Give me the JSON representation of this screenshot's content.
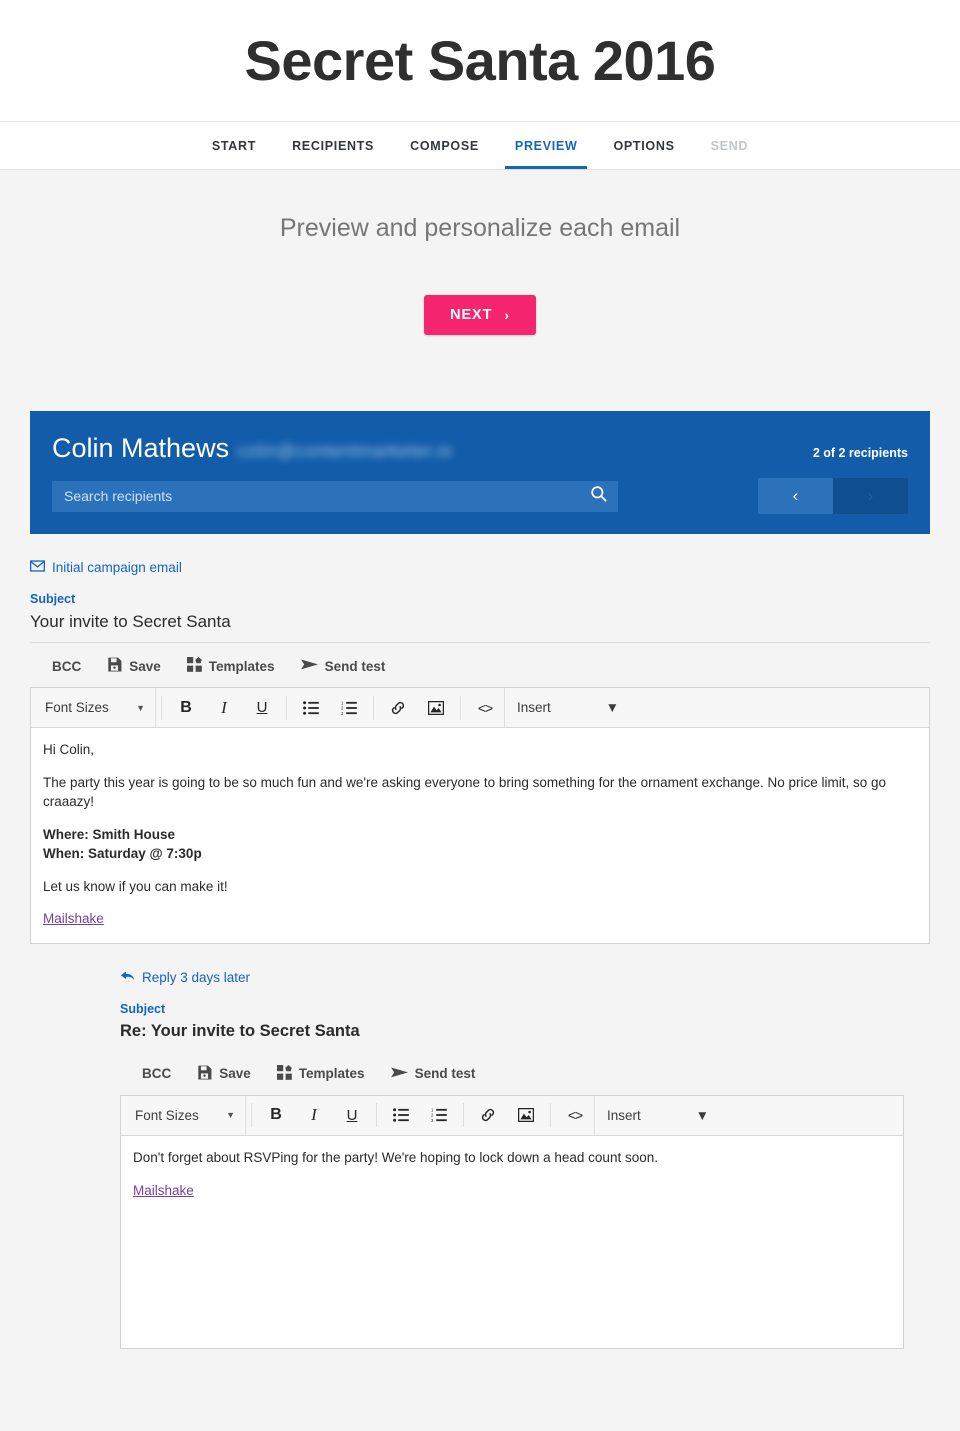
{
  "app": {
    "title": "Secret Santa 2016"
  },
  "nav": {
    "items": [
      {
        "label": "START",
        "state": "normal"
      },
      {
        "label": "RECIPIENTS",
        "state": "normal"
      },
      {
        "label": "COMPOSE",
        "state": "normal"
      },
      {
        "label": "PREVIEW",
        "state": "active"
      },
      {
        "label": "OPTIONS",
        "state": "normal"
      },
      {
        "label": "SEND",
        "state": "disabled"
      }
    ]
  },
  "subhead": {
    "title": "Preview and personalize each email",
    "next_label": "NEXT",
    "next_chevron": "›"
  },
  "recipient": {
    "name": "Colin Mathews",
    "email": "colin@contentmarketer.io",
    "count": "2 of 2 recipients",
    "search_placeholder": "Search recipients",
    "prev_glyph": "‹",
    "next_glyph": "›"
  },
  "emails": [
    {
      "tag": "Initial campaign email",
      "tag_icon": "envelope-icon",
      "subject_label": "Subject",
      "subject": "Your invite to Secret Santa",
      "actions": [
        {
          "label": "BCC",
          "icon": "none"
        },
        {
          "label": "Save",
          "icon": "floppy-disk-icon"
        },
        {
          "label": "Templates",
          "icon": "templates-grid-icon"
        },
        {
          "label": "Send test",
          "icon": "paper-plane-icon"
        }
      ],
      "toolbar": {
        "font_sizes_label": "Font Sizes",
        "bold": "B",
        "italic": "I",
        "underline": "U",
        "code": "<>",
        "insert_label": "Insert"
      },
      "body": {
        "greeting": "Hi Colin,",
        "paragraph": "The party this year is going to be so much fun and we're asking everyone to bring something for the ornament exchange. No price limit, so go craaazy!",
        "where": "Where: Smith House",
        "when": "When: Saturday @ 7:30p",
        "closing": "Let us know if you can make it!",
        "signature_link": "Mailshake"
      }
    },
    {
      "tag": "Reply 3 days later",
      "tag_icon": "reply-arrow-icon",
      "subject_label": "Subject",
      "subject": "Re: Your invite to Secret Santa",
      "actions": [
        {
          "label": "BCC",
          "icon": "none"
        },
        {
          "label": "Save",
          "icon": "floppy-disk-icon"
        },
        {
          "label": "Templates",
          "icon": "templates-grid-icon"
        },
        {
          "label": "Send test",
          "icon": "paper-plane-icon"
        }
      ],
      "toolbar": {
        "font_sizes_label": "Font Sizes",
        "bold": "B",
        "italic": "I",
        "underline": "U",
        "code": "<>",
        "insert_label": "Insert"
      },
      "body": {
        "paragraph": "Don't forget about RSVPing for the party! We're hoping to lock down a head count soon.",
        "signature_link": "Mailshake"
      }
    }
  ],
  "colors": {
    "accent_blue": "#1565c0",
    "header_blue": "#125ca9",
    "next_pink": "#f5256e",
    "page_background": "#f4f4f4",
    "link_purple": "#7b3fa0"
  }
}
